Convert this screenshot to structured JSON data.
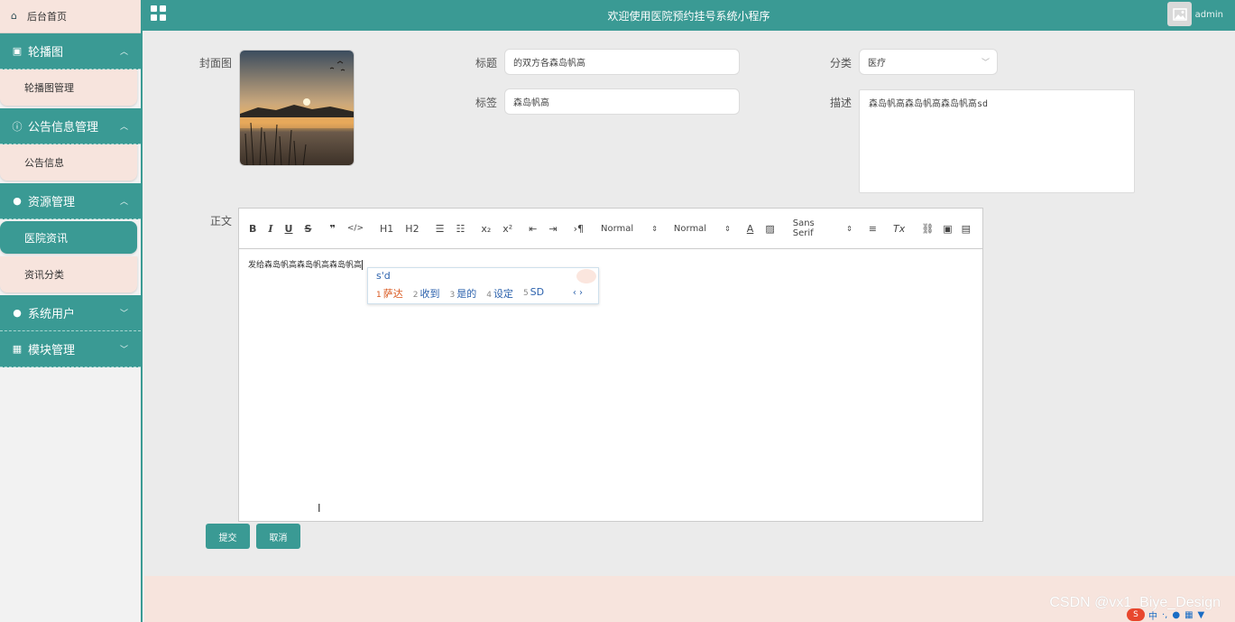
{
  "sidebar": {
    "home": "后台首页",
    "groups": [
      {
        "title": "轮播图",
        "icon": "image-icon",
        "items": [
          {
            "label": "轮播图管理"
          }
        ]
      },
      {
        "title": "公告信息管理",
        "icon": "info-icon",
        "items": [
          {
            "label": "公告信息"
          }
        ]
      },
      {
        "title": "资源管理",
        "icon": "location-pin-icon",
        "items": [
          {
            "label": "医院资讯",
            "active": true
          },
          {
            "label": "资讯分类"
          }
        ]
      },
      {
        "title": "系统用户",
        "icon": "user-icon",
        "items": []
      },
      {
        "title": "模块管理",
        "icon": "grid-icon",
        "items": []
      }
    ]
  },
  "header": {
    "title": "欢迎使用医院预约挂号系统小程序",
    "user": "admin"
  },
  "form": {
    "cover_label": "封面图",
    "title_label": "标题",
    "title_value": "的双方各森岛帆高",
    "category_label": "分类",
    "category_value": "医疗",
    "tag_label": "标签",
    "tag_value": "森岛帆高",
    "desc_label": "描述",
    "desc_value": "森岛帆高森岛帆高森岛帆高sd",
    "body_label": "正文",
    "body_text": "发给森岛帆高森岛帆高森岛帆高",
    "submit": "提交",
    "cancel": "取消"
  },
  "toolbar": {
    "bold": "B",
    "italic": "I",
    "underline": "U",
    "strike": "S",
    "quote": "❞",
    "code": "</>",
    "h1": "H1",
    "h2": "H2",
    "sub": "x₂",
    "sup": "x²",
    "dir": "›¶",
    "size": "Normal",
    "header": "Normal",
    "font": "Sans Serif"
  },
  "ime": {
    "input": "s'd",
    "candidates": [
      {
        "n": "1",
        "text": "萨达"
      },
      {
        "n": "2",
        "text": "收到"
      },
      {
        "n": "3",
        "text": "是的"
      },
      {
        "n": "4",
        "text": "设定"
      },
      {
        "n": "5",
        "text": "SD"
      }
    ],
    "nav": "‹ ›"
  },
  "watermark": "CSDN @vx1_Biye_Design",
  "colors": {
    "primary": "#3a9a94",
    "sidebar_sub": "#f7e4dd",
    "ime_highlight": "#d9581f"
  }
}
